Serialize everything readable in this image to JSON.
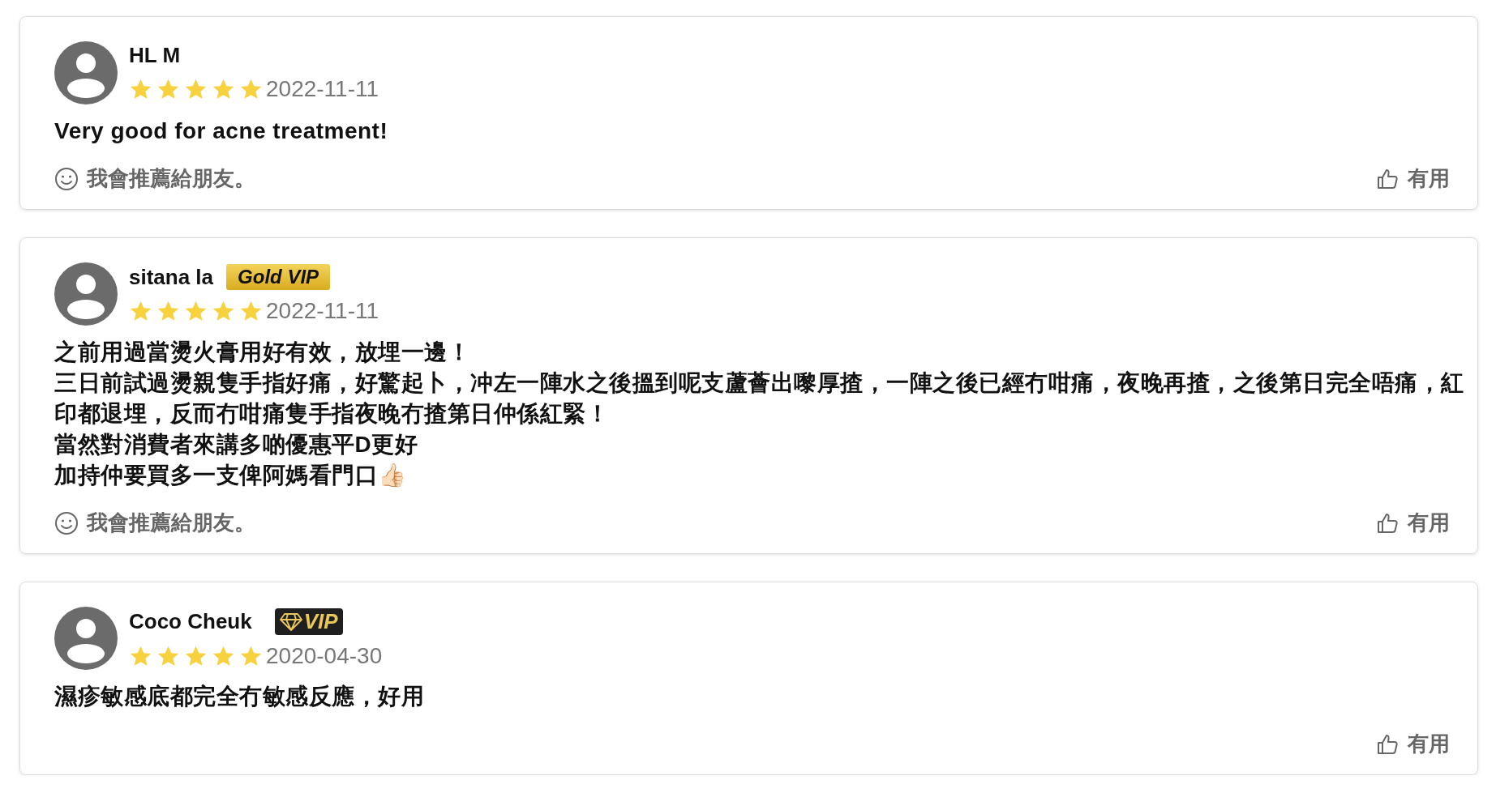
{
  "reviews": [
    {
      "name": "HL M",
      "stars": 5,
      "date": "2022-11-11",
      "text": [
        "Very good for acne treatment!"
      ],
      "recommend": "我會推薦給朋友。",
      "helpful": "有用"
    },
    {
      "name": "sitana la",
      "badge": {
        "kind": "gold",
        "label": "Gold VIP"
      },
      "stars": 5,
      "date": "2022-11-11",
      "text": [
        "之前用過當燙火膏用好有效，放埋一邊！",
        "三日前試過燙親隻手指好痛，好驚起卜，冲左一陣水之後搵到呢支蘆薈出嚟厚揸，一陣之後已經冇咁痛，夜晚再揸，之後第日完全唔痛，紅印都退埋，反而冇咁痛隻手指夜晚冇揸第日仲係紅緊！",
        "當然對消費者來講多啲優惠平D更好",
        "加持仲要買多一支俾阿媽看門口👍🏻"
      ],
      "recommend": "我會推薦給朋友。",
      "helpful": "有用"
    },
    {
      "name": "Coco Cheuk",
      "badge": {
        "kind": "diamond",
        "label": "VIP"
      },
      "stars": 5,
      "date": "2020-04-30",
      "text": [
        "濕疹敏感底都完全冇敏感反應，好用"
      ],
      "helpful": "有用"
    }
  ]
}
